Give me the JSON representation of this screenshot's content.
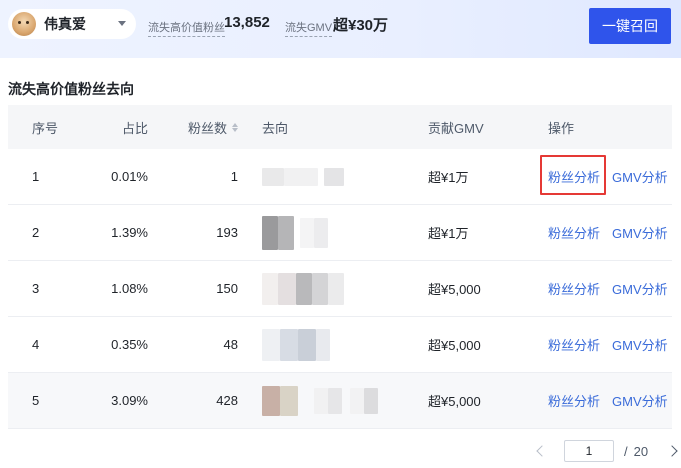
{
  "header": {
    "account_name": "伟真爱",
    "metric1_label": "流失高价值粉丝",
    "metric1_value": "13,852",
    "metric2_label": "流失GMV",
    "metric2_value": "超¥30万",
    "recall_button": "一键召回"
  },
  "section_title": "流失高价值粉丝去向",
  "table": {
    "columns": [
      "序号",
      "占比",
      "粉丝数",
      "去向",
      "贡献GMV",
      "操作"
    ],
    "rows": [
      {
        "idx": "1",
        "ratio": "0.01%",
        "fans": "1",
        "gmv": "超¥1万"
      },
      {
        "idx": "2",
        "ratio": "1.39%",
        "fans": "193",
        "gmv": "超¥1万"
      },
      {
        "idx": "3",
        "ratio": "1.08%",
        "fans": "150",
        "gmv": "超¥5,000"
      },
      {
        "idx": "4",
        "ratio": "0.35%",
        "fans": "48",
        "gmv": "超¥5,000"
      },
      {
        "idx": "5",
        "ratio": "3.09%",
        "fans": "428",
        "gmv": "超¥5,000"
      }
    ],
    "actions": {
      "fan_analysis": "粉丝分析",
      "gmv_analysis": "GMV分析"
    }
  },
  "pagination": {
    "current": "1",
    "separator": "/",
    "total": "20"
  },
  "colors": {
    "primary": "#2f54eb",
    "link": "#3a6bd9",
    "highlight_border": "#e53935"
  }
}
